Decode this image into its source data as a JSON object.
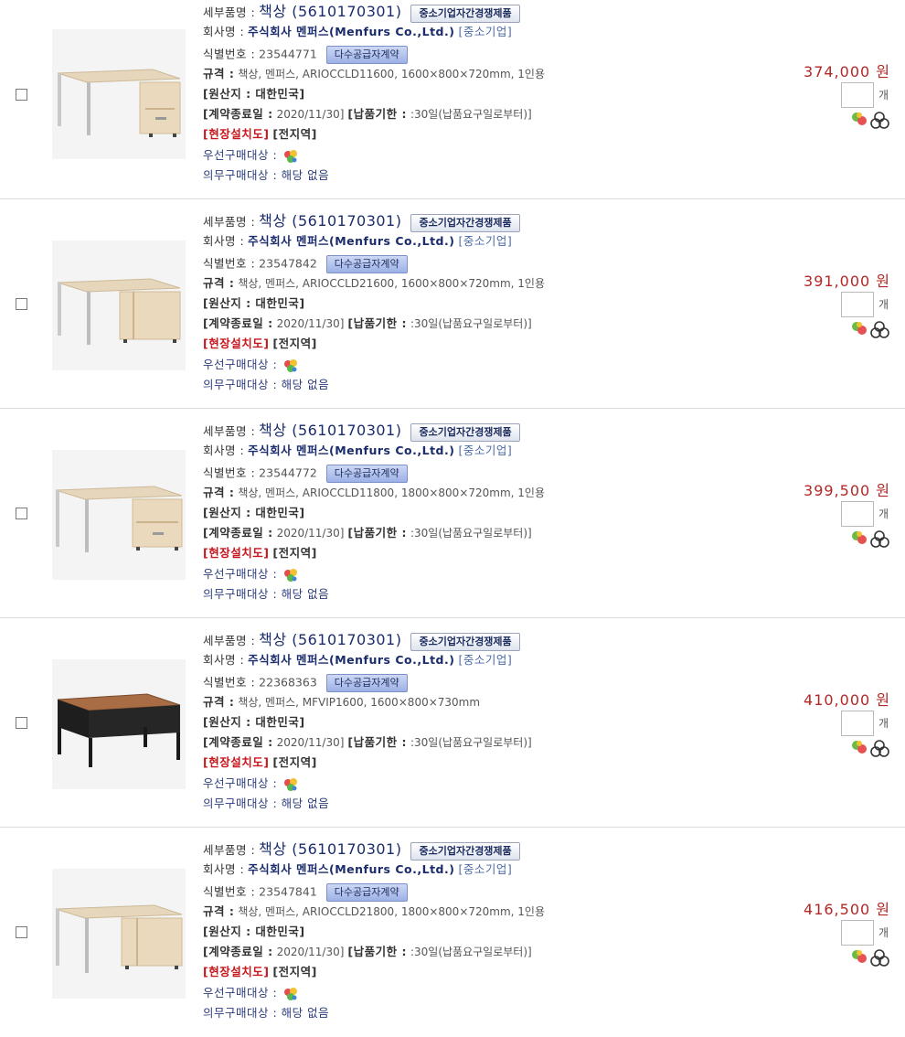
{
  "labels": {
    "product_name": "세부품명 :",
    "company": "회사명 :",
    "id": "식별번호 :",
    "spec": "규격 :",
    "origin": "[원산지 : 대한민국]",
    "contract_end": "[계약종료일 :",
    "delivery": "[납품기한 :",
    "onsite": "[현장설치도]",
    "region": "[전지역]",
    "priority": "우선구매대상 :",
    "mandatory": "의무구매대상 : 해당 없음",
    "sme_badge": "중소기업자간경쟁제품",
    "multi_badge": "다수공급자계약",
    "sme_company": "[중소기업]",
    "unit": "개"
  },
  "icons": {
    "priority": "priority-purchase-icon",
    "green": "green-product-icon",
    "compare": "compare-icon",
    "accent_red": "#c8161d",
    "accent_navy": "#1a2c6b"
  },
  "items": [
    {
      "product": "책상 (5610170301)",
      "company": "주식회사 멘퍼스(Menfurs Co.,Ltd.)",
      "id": "23544771",
      "spec": "책상, 멘퍼스, ARIOCCLD11600, 1600×800×720mm, 1인용",
      "contract_date": "2020/11/30]",
      "delivery_term": ":30일(납품요구일로부터)]",
      "price": "374,000 원",
      "qty": ""
    },
    {
      "product": "책상 (5610170301)",
      "company": "주식회사 멘퍼스(Menfurs Co.,Ltd.)",
      "id": "23547842",
      "spec": "책상, 멘퍼스, ARIOCCLD21600, 1600×800×720mm, 1인용",
      "contract_date": "2020/11/30]",
      "delivery_term": ":30일(납품요구일로부터)]",
      "price": "391,000 원",
      "qty": ""
    },
    {
      "product": "책상 (5610170301)",
      "company": "주식회사 멘퍼스(Menfurs Co.,Ltd.)",
      "id": "23544772",
      "spec": "책상, 멘퍼스, ARIOCCLD11800, 1800×800×720mm, 1인용",
      "contract_date": "2020/11/30]",
      "delivery_term": ":30일(납품요구일로부터)]",
      "price": "399,500 원",
      "qty": ""
    },
    {
      "product": "책상 (5610170301)",
      "company": "주식회사 멘퍼스(Menfurs Co.,Ltd.)",
      "id": "22368363",
      "spec": "책상, 멘퍼스, MFVIP1600, 1600×800×730mm",
      "contract_date": "2020/11/30]",
      "delivery_term": ":30일(납품요구일로부터)]",
      "price": "410,000 원",
      "qty": ""
    },
    {
      "product": "책상 (5610170301)",
      "company": "주식회사 멘퍼스(Menfurs Co.,Ltd.)",
      "id": "23547841",
      "spec": "책상, 멘퍼스, ARIOCCLD21800, 1800×800×720mm, 1인용",
      "contract_date": "2020/11/30]",
      "delivery_term": ":30일(납품요구일로부터)]",
      "price": "416,500 원",
      "qty": ""
    }
  ]
}
